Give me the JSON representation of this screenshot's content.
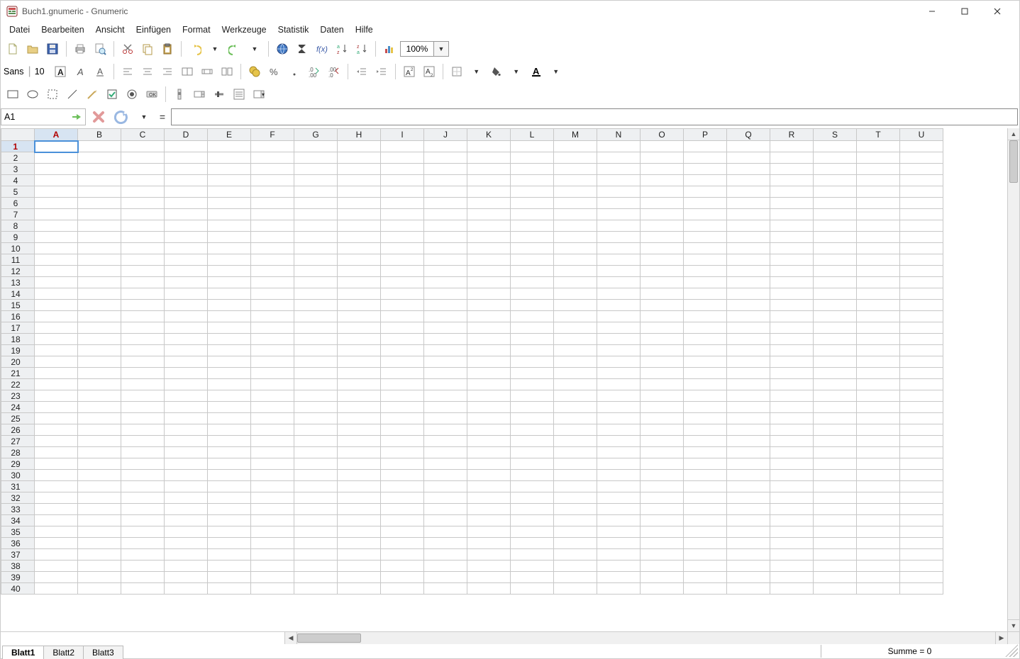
{
  "titlebar": {
    "title": "Buch1.gnumeric - Gnumeric"
  },
  "menu": {
    "items": [
      "Datei",
      "Bearbeiten",
      "Ansicht",
      "Einfügen",
      "Format",
      "Werkzeuge",
      "Statistik",
      "Daten",
      "Hilfe"
    ]
  },
  "toolbar1": {
    "zoom": "100%"
  },
  "toolbar2": {
    "font_name": "Sans",
    "font_size": "10"
  },
  "formula": {
    "cell_ref": "A1",
    "equals": "=",
    "value": ""
  },
  "grid": {
    "columns": [
      "A",
      "B",
      "C",
      "D",
      "E",
      "F",
      "G",
      "H",
      "I",
      "J",
      "K",
      "L",
      "M",
      "N",
      "O",
      "P",
      "Q",
      "R",
      "S",
      "T",
      "U"
    ],
    "rows": 40,
    "selected_col": "A",
    "selected_row": 1
  },
  "sheets": {
    "tabs": [
      "Blatt1",
      "Blatt2",
      "Blatt3"
    ],
    "active": 0
  },
  "status": {
    "sum": "Summe = 0"
  }
}
